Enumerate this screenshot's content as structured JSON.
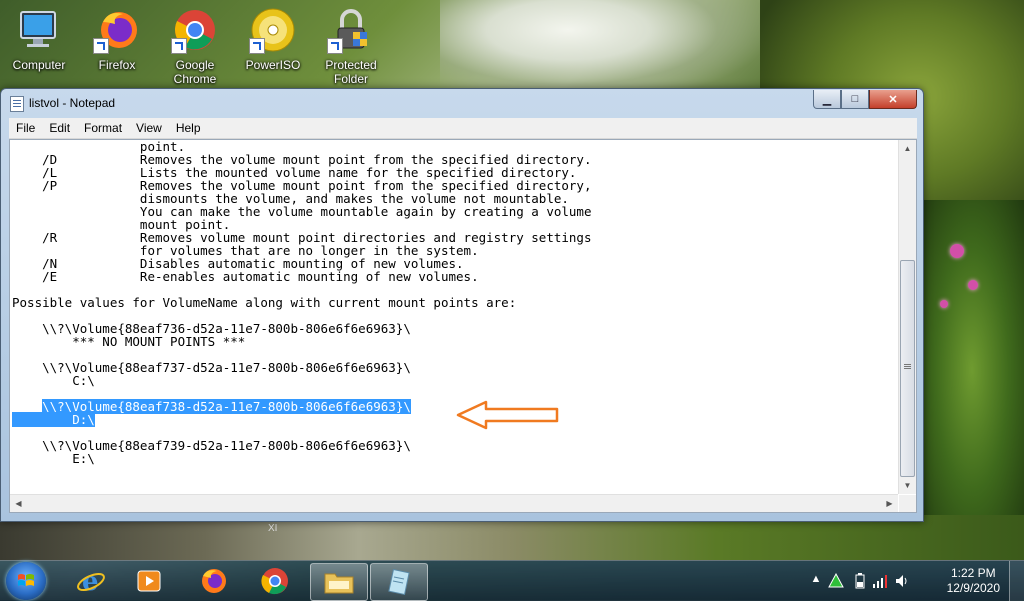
{
  "desktop": {
    "icons": [
      {
        "label": "Computer"
      },
      {
        "label": "Firefox"
      },
      {
        "label": "Google Chrome"
      },
      {
        "label": "PowerISO"
      },
      {
        "label": "Protected Folder"
      }
    ],
    "watermark": "XI"
  },
  "window": {
    "title": "listvol - Notepad",
    "buttons": {
      "minimize": "▁",
      "maximize": "□",
      "close": "✕"
    },
    "menu": [
      "File",
      "Edit",
      "Format",
      "View",
      "Help"
    ],
    "lines": [
      {
        "text": "                 point."
      },
      {
        "text": "    /D           Removes the volume mount point from the specified directory."
      },
      {
        "text": "    /L           Lists the mounted volume name for the specified directory."
      },
      {
        "text": "    /P           Removes the volume mount point from the specified directory,"
      },
      {
        "text": "                 dismounts the volume, and makes the volume not mountable."
      },
      {
        "text": "                 You can make the volume mountable again by creating a volume"
      },
      {
        "text": "                 mount point."
      },
      {
        "text": "    /R           Removes volume mount point directories and registry settings"
      },
      {
        "text": "                 for volumes that are no longer in the system."
      },
      {
        "text": "    /N           Disables automatic mounting of new volumes."
      },
      {
        "text": "    /E           Re-enables automatic mounting of new volumes."
      },
      {
        "text": ""
      },
      {
        "text": "Possible values for VolumeName along with current mount points are:"
      },
      {
        "text": ""
      },
      {
        "text": "    \\\\?\\Volume{88eaf736-d52a-11e7-800b-806e6f6e6963}\\"
      },
      {
        "text": "        *** NO MOUNT POINTS ***"
      },
      {
        "text": ""
      },
      {
        "text": "    \\\\?\\Volume{88eaf737-d52a-11e7-800b-806e6f6e6963}\\"
      },
      {
        "text": "        C:\\"
      },
      {
        "text": ""
      },
      {
        "text": "    \\\\?\\Volume{88eaf738-d52a-11e7-800b-806e6f6e6963}\\",
        "selected": true,
        "lead": "    "
      },
      {
        "text": "        D:\\",
        "selected": true,
        "lead": ""
      },
      {
        "text": ""
      },
      {
        "text": "    \\\\?\\Volume{88eaf739-d52a-11e7-800b-806e6f6e6963}\\"
      },
      {
        "text": "        E:\\"
      }
    ],
    "annotation_color": "#f07a20",
    "selection_color": "#3399ff"
  },
  "taskbar": {
    "items": [
      "internet-explorer",
      "media-player",
      "firefox",
      "chrome",
      "windows-explorer",
      "notepad"
    ],
    "active_item": "notepad",
    "clock": {
      "time": "1:22 PM",
      "date": "12/9/2020"
    }
  }
}
